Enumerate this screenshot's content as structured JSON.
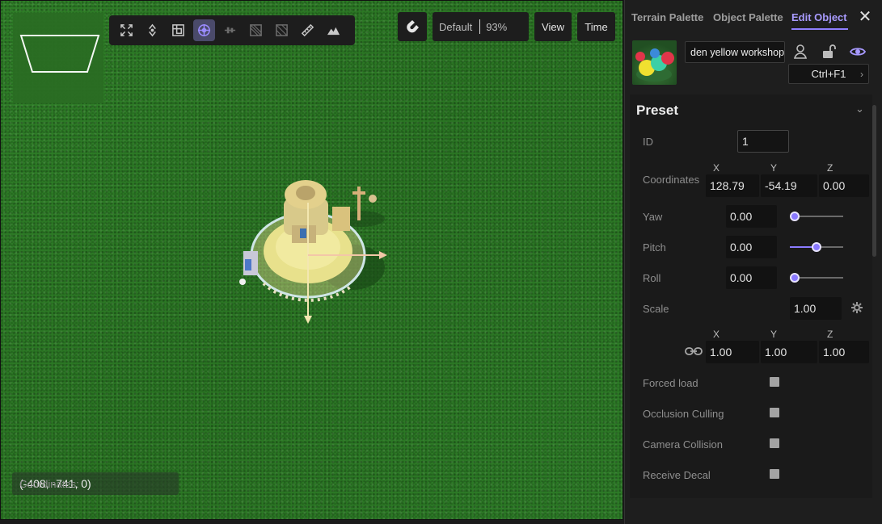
{
  "toolbar": {
    "tools": [
      {
        "name": "fullscreen-icon",
        "state": "normal"
      },
      {
        "name": "rotate-icon",
        "state": "normal"
      },
      {
        "name": "frame-icon",
        "state": "normal"
      },
      {
        "name": "move-gizmo-icon",
        "state": "active"
      },
      {
        "name": "align-icon",
        "state": "dim"
      },
      {
        "name": "snap-grid-icon",
        "state": "dim"
      },
      {
        "name": "snap-grid-2-icon",
        "state": "dim"
      },
      {
        "name": "ruler-icon",
        "state": "normal"
      },
      {
        "name": "terrain-icon",
        "state": "normal"
      }
    ]
  },
  "viewport": {
    "preset_label": "Default",
    "zoom": "93%",
    "view_label": "View",
    "time_label": "Time",
    "coordinates_label": "Coordinates:",
    "coordinates_value": "(-408, -741, 0)"
  },
  "panel": {
    "tabs": [
      "Terrain Palette",
      "Object Palette",
      "Edit Object"
    ],
    "active_tab": "Edit Object",
    "object_name": "den yellow workshop",
    "shortcut": "Ctrl+F1",
    "section_title": "Preset",
    "id_label": "ID",
    "id_value": "1",
    "coordinates_label": "Coordinates",
    "axis_x": "X",
    "axis_y": "Y",
    "axis_z": "Z",
    "coord_x": "128.79",
    "coord_y": "-54.19",
    "coord_z": "0.00",
    "yaw_label": "Yaw",
    "yaw_value": "0.00",
    "yaw_slider": 0.0,
    "pitch_label": "Pitch",
    "pitch_value": "0.00",
    "pitch_slider": 0.5,
    "roll_label": "Roll",
    "roll_value": "0.00",
    "roll_slider": 0.0,
    "scale_label": "Scale",
    "scale_value": "1.00",
    "scale_x": "1.00",
    "scale_y": "1.00",
    "scale_z": "1.00",
    "forced_load_label": "Forced load",
    "occlusion_label": "Occlusion Culling",
    "camera_collision_label": "Camera Collision",
    "receive_decal_label": "Receive Decal"
  },
  "colors": {
    "accent": "#8f7fff",
    "grass": "#2c7a26",
    "panel_bg": "#1e1e1e"
  }
}
